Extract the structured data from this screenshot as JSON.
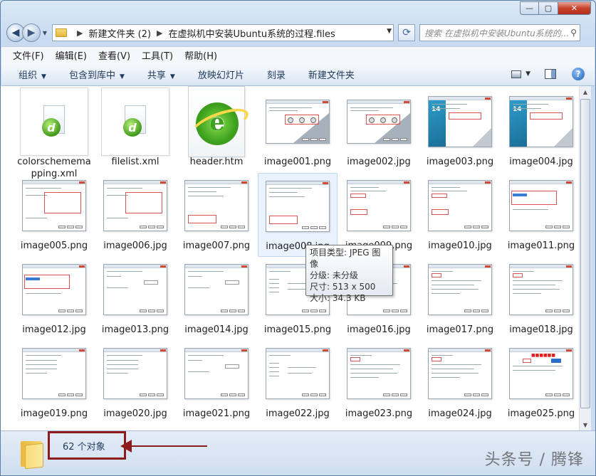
{
  "window": {
    "caption_buttons": {
      "minimize": "—",
      "maximize": "▢",
      "close": "✕"
    }
  },
  "address": {
    "crumbs": [
      "新建文件夹 (2)",
      "在虚拟机中安装Ubuntu系统的过程.files"
    ],
    "search_placeholder": "搜索 在虚拟机中安装Ubuntu系统的..."
  },
  "menu": [
    "文件(F)",
    "编辑(E)",
    "查看(V)",
    "工具(T)",
    "帮助(H)"
  ],
  "toolbar": {
    "organize": "组织",
    "include_in_library": "包含到库中",
    "share": "共享",
    "slideshow": "放映幻灯片",
    "burn": "刻录",
    "new_folder": "新建文件夹"
  },
  "files": [
    {
      "name": "colorschememapping.xml",
      "kind": "dw"
    },
    {
      "name": "filelist.xml",
      "kind": "dw"
    },
    {
      "name": "header.htm",
      "kind": "ie"
    },
    {
      "name": "image001.png",
      "kind": "shotA"
    },
    {
      "name": "image002.jpg",
      "kind": "shotA"
    },
    {
      "name": "image003.png",
      "kind": "shotB"
    },
    {
      "name": "image004.jpg",
      "kind": "shotB"
    },
    {
      "name": "image005.png",
      "kind": "shotC"
    },
    {
      "name": "image006.jpg",
      "kind": "shotC"
    },
    {
      "name": "image007.png",
      "kind": "shotD"
    },
    {
      "name": "image008.jpg",
      "kind": "shotD"
    },
    {
      "name": "image009.png",
      "kind": "shotE"
    },
    {
      "name": "image010.jpg",
      "kind": "shotE"
    },
    {
      "name": "image011.png",
      "kind": "shotF"
    },
    {
      "name": "image012.jpg",
      "kind": "shotF"
    },
    {
      "name": "image013.png",
      "kind": "shotG"
    },
    {
      "name": "image014.jpg",
      "kind": "shotG"
    },
    {
      "name": "image015.png",
      "kind": "shotH"
    },
    {
      "name": "image016.jpg",
      "kind": "shotH"
    },
    {
      "name": "image017.png",
      "kind": "shotI"
    },
    {
      "name": "image018.jpg",
      "kind": "shotI"
    },
    {
      "name": "image019.png",
      "kind": "shotJ"
    },
    {
      "name": "image020.jpg",
      "kind": "shotJ"
    },
    {
      "name": "image021.png",
      "kind": "shotG"
    },
    {
      "name": "image022.jpg",
      "kind": "shotH"
    },
    {
      "name": "image023.png",
      "kind": "shotI"
    },
    {
      "name": "image024.jpg",
      "kind": "shotI"
    },
    {
      "name": "image025.png",
      "kind": "shotK"
    }
  ],
  "tooltip": {
    "type": "项目类型: JPEG 图像",
    "rating": "分级: 未分级",
    "dimensions": "尺寸: 513 x 500",
    "size": "大小: 34.3 KB"
  },
  "status": {
    "count": "62 个对象"
  },
  "watermark": "头条号 / 腾锋",
  "colors": {
    "annotation": "#8e1b1b",
    "accent": "#1e395b"
  }
}
